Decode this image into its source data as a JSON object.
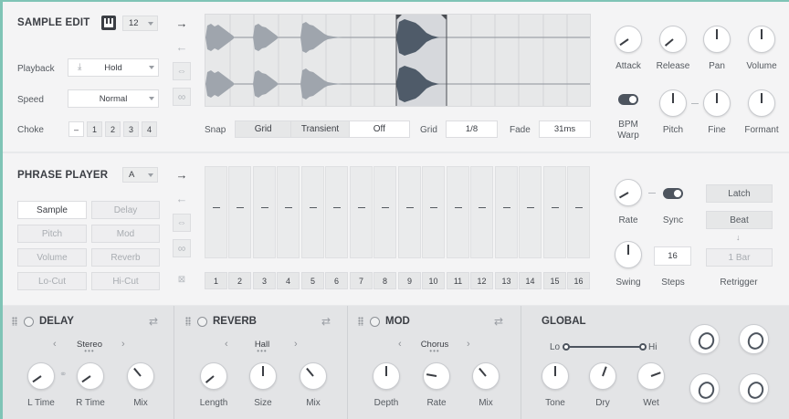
{
  "sample_edit": {
    "title": "SAMPLE EDIT",
    "number_select": "12",
    "playback_label": "Playback",
    "playback_value": "Hold",
    "speed_label": "Speed",
    "speed_value": "Normal",
    "choke_label": "Choke",
    "choke_buttons": [
      "–",
      "1",
      "2",
      "3",
      "4"
    ],
    "snap_label": "Snap",
    "snap_options": [
      "Grid",
      "Transient",
      "Off"
    ],
    "snap_selected": "Off",
    "grid_label": "Grid",
    "grid_value": "1/8",
    "fade_label": "Fade",
    "fade_value": "31ms",
    "knobs": {
      "attack": "Attack",
      "release": "Release",
      "pan": "Pan",
      "volume": "Volume",
      "bpm_warp": "BPM\nWarp",
      "pitch": "Pitch",
      "fine": "Fine",
      "formant": "Formant"
    }
  },
  "phrase_player": {
    "title": "PHRASE PLAYER",
    "pattern_select": "A",
    "buttons": [
      "Sample",
      "Delay",
      "Pitch",
      "Mod",
      "Volume",
      "Reverb",
      "Lo-Cut",
      "Hi-Cut"
    ],
    "selected_button": "Sample",
    "step_values": [
      "–",
      "–",
      "–",
      "–",
      "–",
      "–",
      "–",
      "–",
      "–",
      "–",
      "–",
      "–",
      "–",
      "–",
      "–",
      "–"
    ],
    "step_numbers": [
      "1",
      "2",
      "3",
      "4",
      "5",
      "6",
      "7",
      "8",
      "9",
      "10",
      "11",
      "12",
      "13",
      "14",
      "15",
      "16"
    ],
    "rate_label": "Rate",
    "sync_label": "Sync",
    "latch_label": "Latch",
    "beat_label": "Beat",
    "bar_label": "1 Bar",
    "swing_label": "Swing",
    "steps_label": "Steps",
    "steps_value": "16",
    "retrigger_label": "Retrigger"
  },
  "delay": {
    "title": "DELAY",
    "preset": "Stereo",
    "knobs": [
      "L Time",
      "R Time",
      "Mix"
    ]
  },
  "reverb": {
    "title": "REVERB",
    "preset": "Hall",
    "knobs": [
      "Length",
      "Size",
      "Mix"
    ]
  },
  "mod": {
    "title": "MOD",
    "preset": "Chorus",
    "knobs": [
      "Depth",
      "Rate",
      "Mix"
    ]
  },
  "global": {
    "title": "GLOBAL",
    "lo_label": "Lo",
    "hi_label": "Hi",
    "knobs": [
      "Tone",
      "Dry",
      "Wet"
    ]
  },
  "icons": {
    "keyboard": "keyboard-icon",
    "arrow_right": "arrow-right-icon",
    "arrow_left": "arrow-left-icon",
    "pingpong": "pingpong-icon",
    "loop": "loop-icon",
    "swap": "swap-icon"
  },
  "colors": {
    "accent": "#7fc4b6",
    "waveform": "#9fa5ad",
    "waveform_selected": "#4f5b69"
  }
}
